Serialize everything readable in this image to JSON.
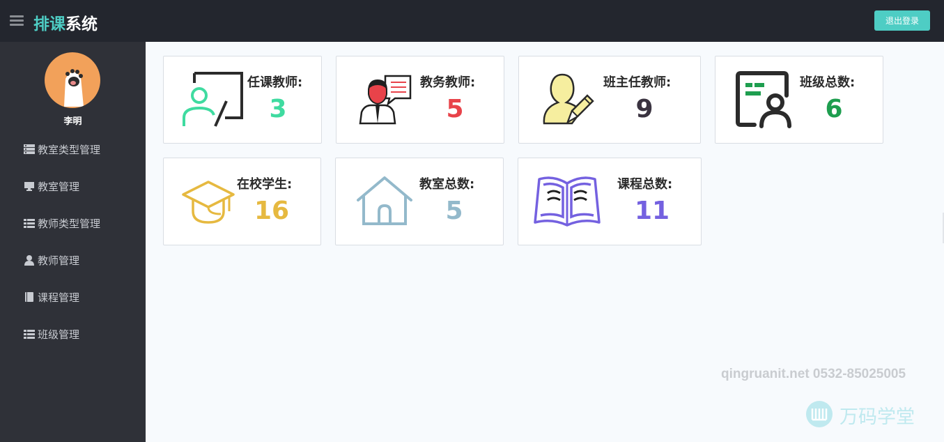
{
  "header": {
    "brand_part1": "排课",
    "brand_part2": "系统",
    "logout_label": "退出登录",
    "menu_icon": "hamburger-menu-icon"
  },
  "sidebar": {
    "user_name": "李明",
    "avatar_icon": "paw-avatar-icon",
    "items": [
      {
        "label": "教室类型管理",
        "icon": "server-icon"
      },
      {
        "label": "教室管理",
        "icon": "monitor-icon"
      },
      {
        "label": "教师类型管理",
        "icon": "list-icon"
      },
      {
        "label": "教师管理",
        "icon": "user-icon"
      },
      {
        "label": "课程管理",
        "icon": "book-icon"
      },
      {
        "label": "班级管理",
        "icon": "list-icon"
      }
    ]
  },
  "cards": [
    {
      "title": "任课教师:",
      "value": "3",
      "color": "#3fdba0",
      "icon": "teacher-board-icon"
    },
    {
      "title": "教务教师:",
      "value": "5",
      "color": "#e8434a",
      "icon": "presenter-icon"
    },
    {
      "title": "班主任教师:",
      "value": "9",
      "color": "#3a3340",
      "icon": "user-pencil-icon"
    },
    {
      "title": "班级总数:",
      "value": "6",
      "color": "#1e9e4f",
      "icon": "class-card-icon"
    },
    {
      "title": "在校学生:",
      "value": "16",
      "color": "#e6b940",
      "icon": "graduation-cap-icon"
    },
    {
      "title": "教室总数:",
      "value": "5",
      "color": "#93b9cb",
      "icon": "house-icon"
    },
    {
      "title": "课程总数:",
      "value": "11",
      "color": "#7461e0",
      "icon": "open-book-icon"
    }
  ],
  "watermark": {
    "contact": "qingruanit.net 0532-85025005",
    "brand": "万码学堂"
  }
}
